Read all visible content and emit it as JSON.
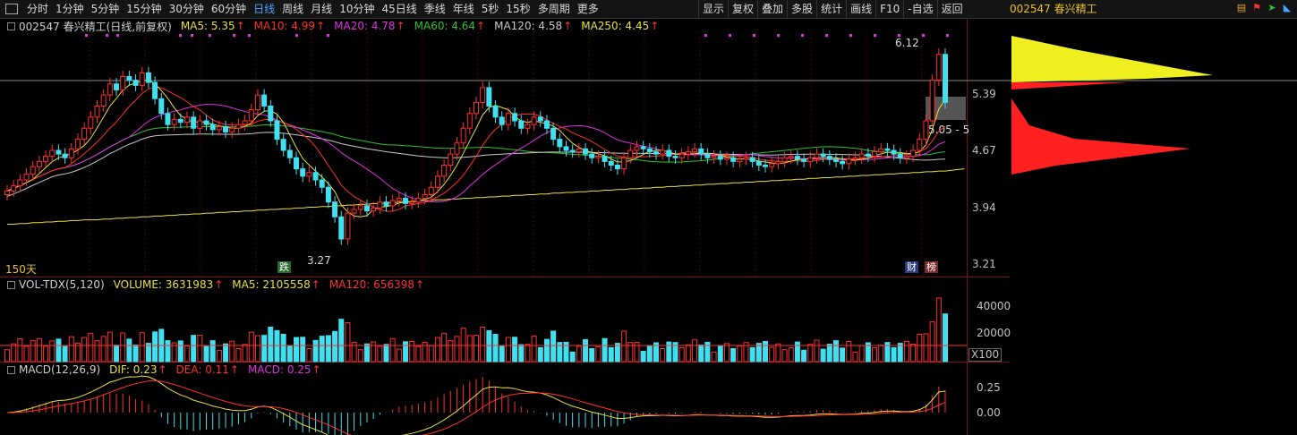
{
  "periods": [
    "分时",
    "1分钟",
    "5分钟",
    "15分钟",
    "30分钟",
    "60分钟",
    "日线",
    "周线",
    "月线",
    "10分钟",
    "45日线",
    "季线",
    "年线",
    "5秒",
    "15秒",
    "多周期",
    "更多"
  ],
  "active_period": "日线",
  "tools": [
    "显示",
    "复权",
    "叠加",
    "多股",
    "统计",
    "画线",
    "F10",
    "-自选",
    "返回"
  ],
  "stock_title": "002547 春兴精工",
  "ma_legend": {
    "title": "002547 春兴精工(日线,前复权)",
    "items": [
      {
        "label": "MA5: 5.35",
        "color": "#e8e040"
      },
      {
        "label": "MA10: 4.99",
        "color": "#ff3030"
      },
      {
        "label": "MA20: 4.78",
        "color": "#e030e0"
      },
      {
        "label": "MA60: 4.64",
        "color": "#30c030"
      },
      {
        "label": "MA120: 4.58",
        "color": "#c8c8c8"
      },
      {
        "label": "MA250: 4.45",
        "color": "#e8e040"
      }
    ]
  },
  "price_ticks": [
    "5.39",
    "4.67",
    "3.94",
    "3.21"
  ],
  "day_count": "150天",
  "high_label": "6.12",
  "low_label": "3.27",
  "current_label": "5.05 - 5",
  "badges": {
    "die": "跌",
    "cai": "财",
    "bang": "榜"
  },
  "vol_legend": {
    "title": "VOL-TDX(5,120)",
    "items": [
      {
        "label": "VOLUME: 3631983",
        "color": "#e8e040"
      },
      {
        "label": "MA5: 2105558",
        "color": "#e8e040"
      },
      {
        "label": "MA120: 656398",
        "color": "#ff3030"
      }
    ]
  },
  "vol_ticks": [
    "40000",
    "20000"
  ],
  "vol_unit": "X100",
  "macd_legend": {
    "title": "MACD(12,26,9)",
    "items": [
      {
        "label": "DIF: 0.23",
        "color": "#e8e040"
      },
      {
        "label": "DEA: 0.11",
        "color": "#ff3030"
      },
      {
        "label": "MACD: 0.25",
        "color": "#e030e0"
      }
    ]
  },
  "macd_ticks": [
    "0.25",
    "0.00"
  ],
  "chart_data": {
    "type": "candlestick",
    "price_range": [
      3.1,
      6.3
    ],
    "closes": [
      4.15,
      4.22,
      4.3,
      4.38,
      4.48,
      4.55,
      4.62,
      4.7,
      4.65,
      4.6,
      4.72,
      4.85,
      5.0,
      5.15,
      5.3,
      5.45,
      5.6,
      5.52,
      5.7,
      5.65,
      5.58,
      5.75,
      5.62,
      5.4,
      5.2,
      5.05,
      5.12,
      5.08,
      5.15,
      5.0,
      5.1,
      5.05,
      4.98,
      5.02,
      4.95,
      5.0,
      5.05,
      5.1,
      5.25,
      5.45,
      5.3,
      5.1,
      4.85,
      4.7,
      4.6,
      4.45,
      4.35,
      4.4,
      4.3,
      4.2,
      4.0,
      3.8,
      3.5,
      3.85,
      3.9,
      3.95,
      3.88,
      3.92,
      4.0,
      3.95,
      4.02,
      4.05,
      3.98,
      4.0,
      4.05,
      4.1,
      4.2,
      4.35,
      4.5,
      4.65,
      4.8,
      5.0,
      5.2,
      5.35,
      5.55,
      5.3,
      5.15,
      5.05,
      5.2,
      5.1,
      5.0,
      5.05,
      5.15,
      5.1,
      5.0,
      4.85,
      4.75,
      4.7,
      4.68,
      4.72,
      4.65,
      4.6,
      4.62,
      4.55,
      4.5,
      4.45,
      4.6,
      4.7,
      4.75,
      4.72,
      4.68,
      4.65,
      4.7,
      4.62,
      4.6,
      4.65,
      4.68,
      4.72,
      4.65,
      4.6,
      4.62,
      4.58,
      4.6,
      4.55,
      4.58,
      4.6,
      4.55,
      4.5,
      4.48,
      4.52,
      4.55,
      4.6,
      4.62,
      4.58,
      4.55,
      4.6,
      4.65,
      4.62,
      4.58,
      4.55,
      4.52,
      4.58,
      4.6,
      4.65,
      4.62,
      4.68,
      4.72,
      4.7,
      4.65,
      4.6,
      4.62,
      4.7,
      4.85,
      5.1,
      5.65,
      6.0,
      5.35
    ],
    "ma250": [
      3.7,
      3.7,
      3.71,
      3.71,
      3.72,
      3.72,
      3.73,
      3.73,
      3.74,
      3.74,
      3.75,
      3.75,
      3.76,
      3.76,
      3.76,
      3.77,
      3.77,
      3.78,
      3.78,
      3.79,
      3.79,
      3.8,
      3.8,
      3.81,
      3.81,
      3.82,
      3.82,
      3.83,
      3.83,
      3.84,
      3.84,
      3.85,
      3.85,
      3.86,
      3.86,
      3.87,
      3.87,
      3.88,
      3.88,
      3.89,
      3.89,
      3.9,
      3.9,
      3.91,
      3.91,
      3.92,
      3.92,
      3.93,
      3.93,
      3.94,
      3.94,
      3.95,
      3.95,
      3.96,
      3.96,
      3.97,
      3.97,
      3.98,
      3.98,
      3.99,
      3.99,
      4.0,
      4.0,
      4.01,
      4.01,
      4.02,
      4.02,
      4.03,
      4.03,
      4.04,
      4.04,
      4.05,
      4.05,
      4.06,
      4.06,
      4.07,
      4.07,
      4.08,
      4.08,
      4.09,
      4.09,
      4.1,
      4.1,
      4.11,
      4.11,
      4.12,
      4.12,
      4.13,
      4.13,
      4.14,
      4.14,
      4.15,
      4.15,
      4.16,
      4.16,
      4.17,
      4.17,
      4.18,
      4.18,
      4.19,
      4.19,
      4.2,
      4.2,
      4.21,
      4.21,
      4.22,
      4.22,
      4.23,
      4.23,
      4.24,
      4.24,
      4.25,
      4.25,
      4.26,
      4.26,
      4.27,
      4.27,
      4.28,
      4.28,
      4.29,
      4.29,
      4.3,
      4.3,
      4.31,
      4.31,
      4.32,
      4.32,
      4.33,
      4.33,
      4.34,
      4.34,
      4.35,
      4.35,
      4.36,
      4.36,
      4.37,
      4.37,
      4.38,
      4.38,
      4.39,
      4.39,
      4.4,
      4.4,
      4.41,
      4.41,
      4.42,
      4.42,
      4.43,
      4.44,
      4.45
    ]
  }
}
